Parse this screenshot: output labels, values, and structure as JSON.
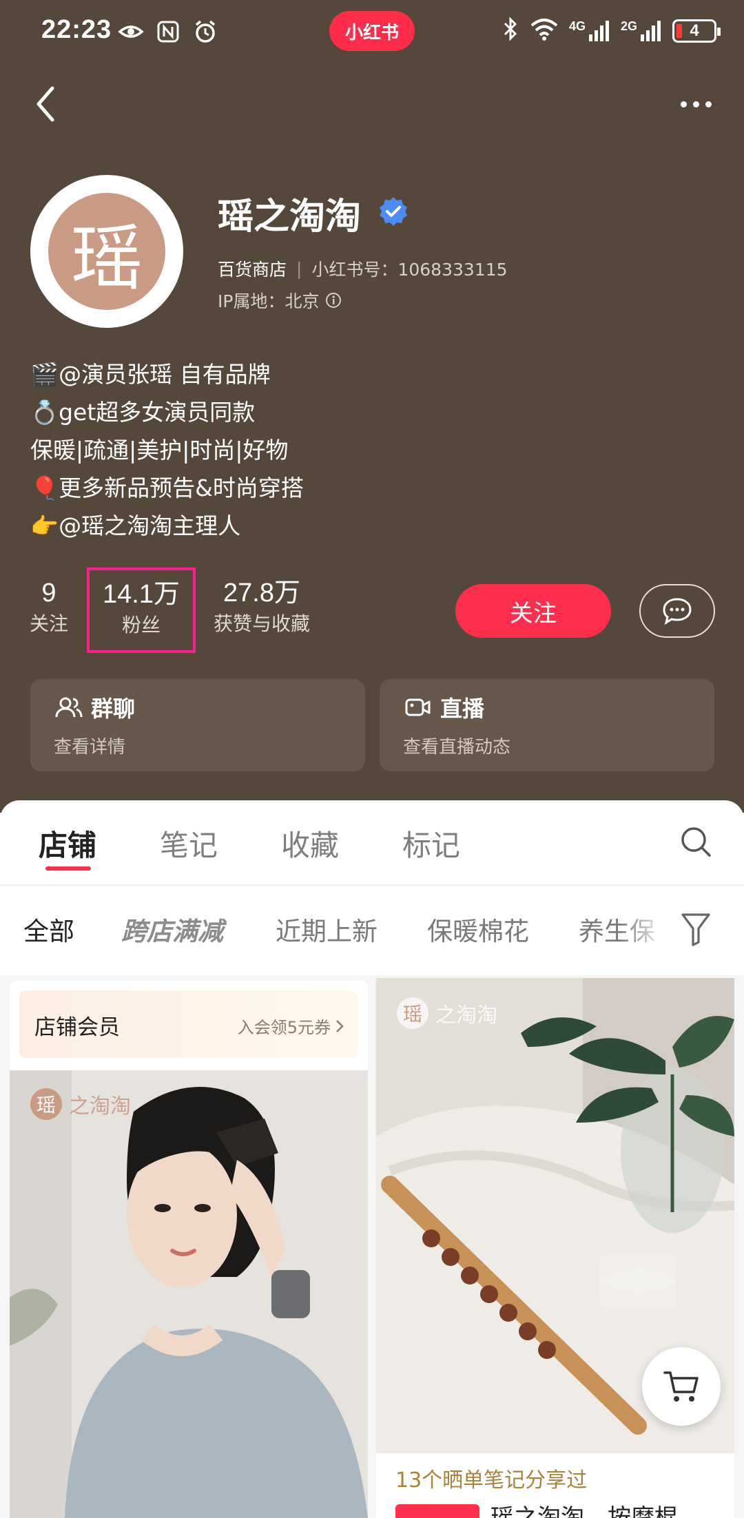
{
  "status_bar": {
    "time": "22:23",
    "network_4g": "4G",
    "network_2g": "2G",
    "battery": "4",
    "icons": [
      "eye-icon",
      "nfc-icon",
      "alarm-icon",
      "bluetooth-icon",
      "wifi-icon",
      "signal-icon",
      "battery-icon"
    ]
  },
  "app_badge": "小红书",
  "profile": {
    "name": "瑶之淘淘",
    "avatar_char": "瑶",
    "category": "百货商店",
    "id_label": "小红书号：1068333115",
    "ip_label": "IP属地：北京",
    "verified": true
  },
  "bio": [
    "🎬@演员张瑶 自有品牌",
    "💍get超多女演员同款",
    "保暖|疏通|美护|时尚|好物",
    "🎈更多新品预告&时尚穿搭",
    "👉@瑶之淘淘主理人"
  ],
  "stats": {
    "following": {
      "value": "9",
      "label": "关注"
    },
    "fans": {
      "value": "14.1万",
      "label": "粉丝"
    },
    "likes": {
      "value": "27.8万",
      "label": "获赞与收藏"
    }
  },
  "actions": {
    "follow_label": "关注"
  },
  "cards": {
    "group": {
      "title": "群聊",
      "subtitle": "查看详情"
    },
    "live": {
      "title": "直播",
      "subtitle": "查看直播动态"
    }
  },
  "tabs": [
    "店铺",
    "笔记",
    "收藏",
    "标记"
  ],
  "active_tab": "店铺",
  "filters": [
    "全部",
    "跨店满减",
    "近期上新",
    "保暖棉花",
    "养生保"
  ],
  "member": {
    "title": "店铺会员",
    "cta": "入会领5元券"
  },
  "watermark": "之淘淘",
  "products": [
    {
      "note": "13个晒单笔记分享过",
      "title": "瑶之淘淘　按摩棍"
    }
  ],
  "colors": {
    "header_bg": "#56473b",
    "accent": "#ff2e4d",
    "highlight_box": "#ff1e8e"
  }
}
